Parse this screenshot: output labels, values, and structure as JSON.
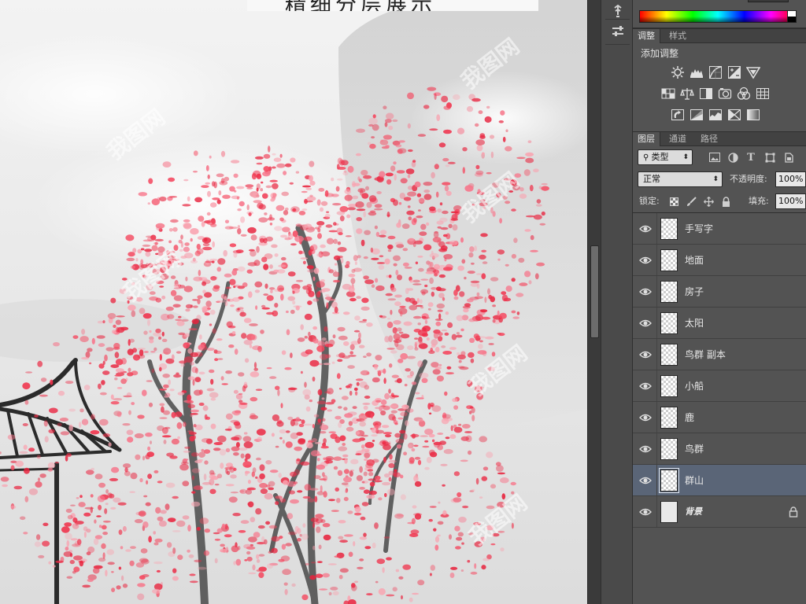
{
  "canvas": {
    "title_text": "精细分层展示",
    "watermark_text": "我图网"
  },
  "toolstrip": {
    "tools": [
      "puppet-warp-icon",
      "properties-icon"
    ]
  },
  "color": {
    "spectrum": [
      "#ff0000",
      "#ffff00",
      "#00ff00",
      "#00ffff",
      "#0000ff",
      "#ff00ff"
    ]
  },
  "adjust_panel": {
    "tabs": [
      {
        "label": "调整",
        "active": true
      },
      {
        "label": "样式",
        "active": false
      }
    ],
    "title": "添加调整",
    "icons": [
      [
        "brightness-contrast-icon",
        "levels-icon",
        "curves-icon",
        "exposure-icon",
        "vibrance-icon"
      ],
      [
        "hue-saturation-icon",
        "color-balance-icon",
        "black-white-icon",
        "photo-filter-icon",
        "channel-mixer-icon",
        "color-lookup-icon"
      ],
      [
        "invert-icon",
        "posterize-icon",
        "threshold-icon",
        "selective-color-icon",
        "gradient-map-icon"
      ]
    ]
  },
  "layers_panel": {
    "tabs": [
      {
        "label": "图层",
        "active": true
      },
      {
        "label": "通道",
        "active": false
      },
      {
        "label": "路径",
        "active": false
      }
    ],
    "filter_type": "类型",
    "blend_mode": "正常",
    "opacity_label": "不透明度:",
    "opacity_value": "100%",
    "lock_label": "锁定:",
    "fill_label": "填充:",
    "fill_value": "100%",
    "layers": [
      {
        "name": "手写字",
        "selected": false,
        "locked": false,
        "visible": true
      },
      {
        "name": "地面",
        "selected": false,
        "locked": false,
        "visible": true
      },
      {
        "name": "房子",
        "selected": false,
        "locked": false,
        "visible": true
      },
      {
        "name": "太阳",
        "selected": false,
        "locked": false,
        "visible": true
      },
      {
        "name": "鸟群 副本",
        "selected": false,
        "locked": false,
        "visible": true
      },
      {
        "name": "小船",
        "selected": false,
        "locked": false,
        "visible": true
      },
      {
        "name": "鹿",
        "selected": false,
        "locked": false,
        "visible": true
      },
      {
        "name": "鸟群",
        "selected": false,
        "locked": false,
        "visible": true
      },
      {
        "name": "群山",
        "selected": true,
        "locked": false,
        "visible": true
      },
      {
        "name": "背景",
        "selected": false,
        "locked": true,
        "visible": true
      }
    ]
  },
  "colors": {
    "panel_bg": "#535353",
    "selected_row": "#5a6577",
    "blossom": "#f0304a",
    "canvas_bg": "#e7e7e7"
  }
}
